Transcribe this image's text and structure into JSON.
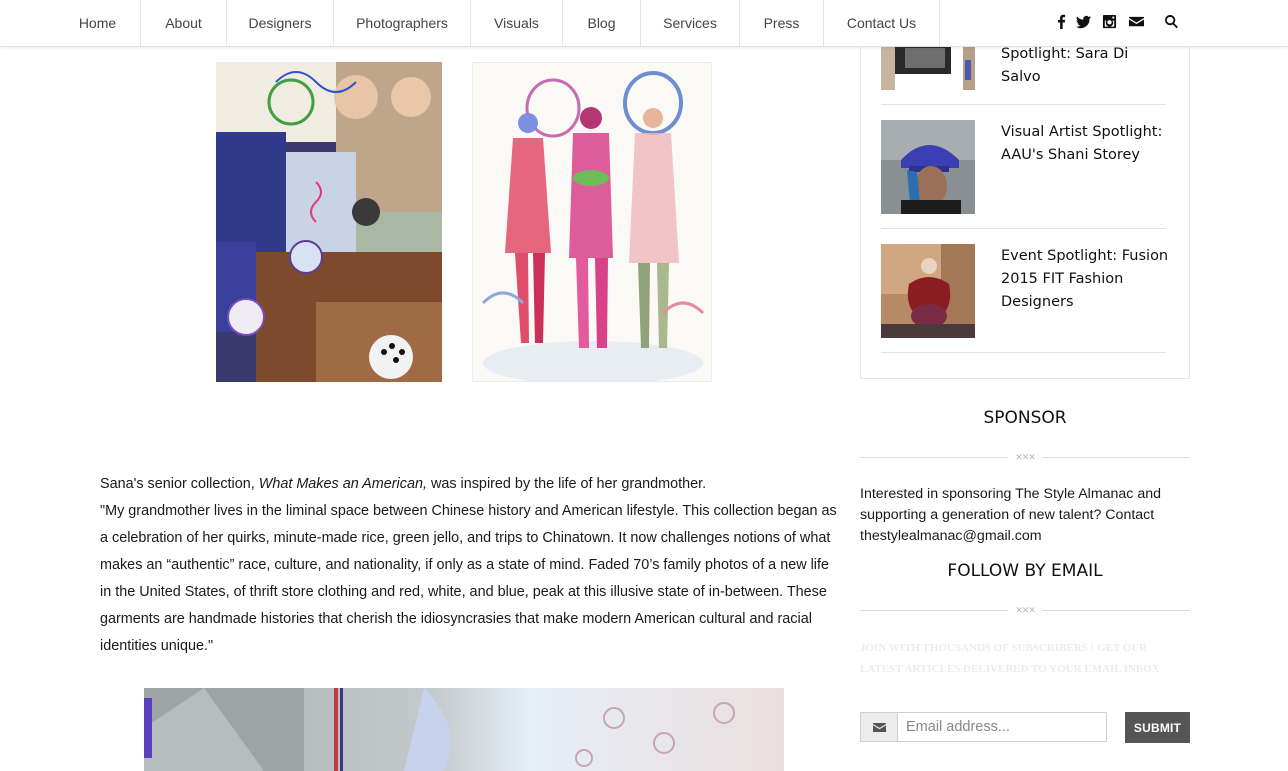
{
  "nav": {
    "items": [
      {
        "label": "Home"
      },
      {
        "label": "About"
      },
      {
        "label": "Designers"
      },
      {
        "label": "Photographers"
      },
      {
        "label": "Visuals"
      },
      {
        "label": "Blog"
      },
      {
        "label": "Services"
      },
      {
        "label": "Press"
      },
      {
        "label": "Contact Us"
      }
    ],
    "social_icons": [
      "facebook-icon",
      "twitter-icon",
      "instagram-icon",
      "envelope-icon",
      "search-icon"
    ]
  },
  "article": {
    "intro_before": "Sana's senior collection, ",
    "intro_title": "What Makes an American,",
    "intro_after": " was inspired by the life of her grandmother.",
    "quote": "\"My grandmother lives in the liminal space between Chinese history and American lifestyle. This collection began as a celebration of her quirks, minute-made rice, green jello, and trips to Chinatown. It now challenges notions of what makes an “authentic” race, culture, and nationality, if only as a state of mind. Faded 70’s family photos of a new life in the United States, of thrift store clothing and red, white, and blue, peak at this illusive state of in-between. These garments are handmade histories that cherish the idiosyncrasies that make modern American cultural and racial identities unique.\""
  },
  "sidebar": {
    "posts": [
      {
        "title": "Spotlight: Sara Di Salvo"
      },
      {
        "title": "Visual Artist Spotlight: AAU's Shani Storey"
      },
      {
        "title": "Event Spotlight: Fusion 2015 FIT Fashion Designers"
      }
    ],
    "sponsor": {
      "title": "SPONSOR",
      "text": "Interested in sponsoring The Style Almanac and supporting a generation of new talent? Contact thestylealmanac@gmail.com"
    },
    "follow": {
      "title": "FOLLOW BY EMAIL",
      "note": "JOIN WITH THOUSANDS OF SUBSCRIBERS ! GET OUR LATEST ARTICLES DELIVERED TO YOUR EMAIL INBOX",
      "email_placeholder": "Email address...",
      "submit_label": "SUBMIT"
    },
    "divider_ornament": "✕✕✕"
  },
  "colors": {
    "text": "#111111",
    "submit_bg": "#555555",
    "rule": "#e3e3e3"
  }
}
